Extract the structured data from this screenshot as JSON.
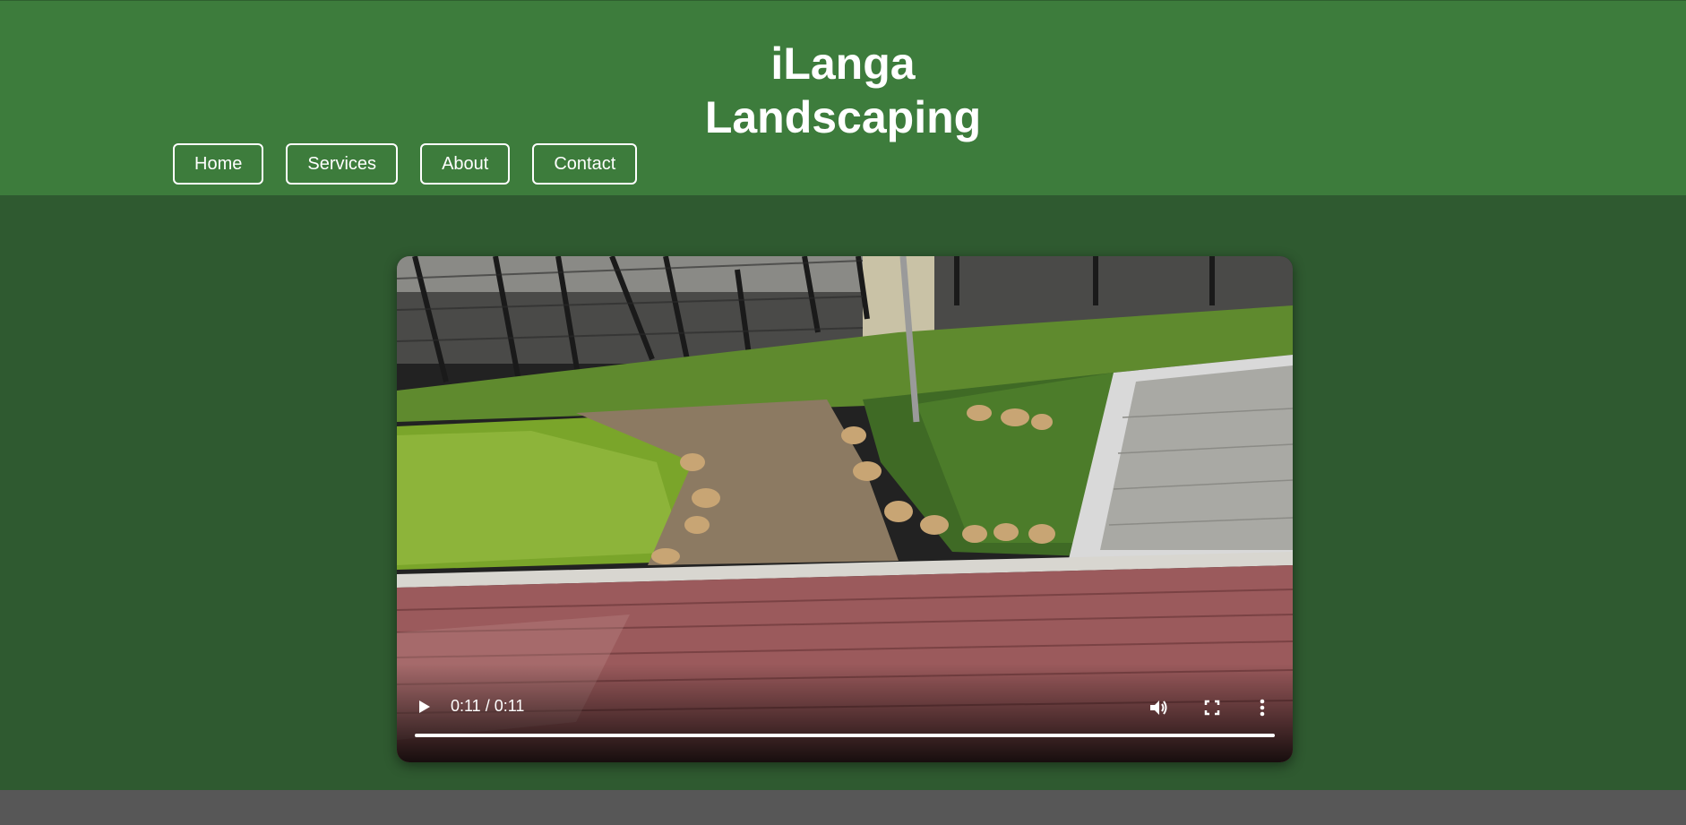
{
  "header": {
    "title_line1": "iLanga",
    "title_line2": "Landscaping"
  },
  "nav": {
    "items": [
      "Home",
      "Services",
      "About",
      "Contact"
    ]
  },
  "video": {
    "time": "0:11 / 0:11",
    "progress": 1.0,
    "icons": [
      "play-icon",
      "volume-icon",
      "fullscreen-icon",
      "more-options-icon"
    ]
  },
  "colors": {
    "header_bg": "#3d7c3c",
    "main_bg": "#2f5a30",
    "footer_bg": "#575757"
  }
}
